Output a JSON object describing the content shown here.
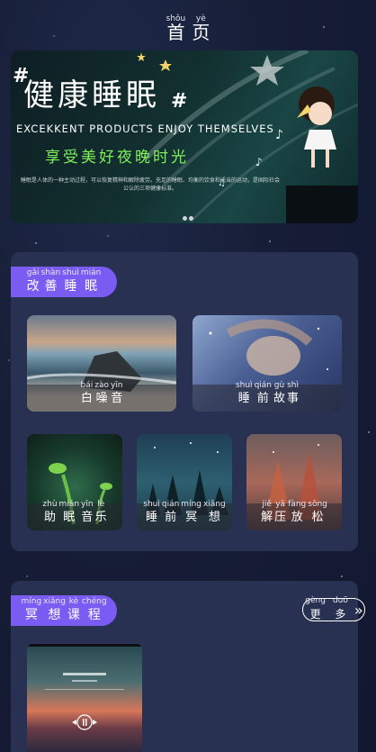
{
  "header": {
    "title": [
      {
        "py": "shǒu",
        "hz": "首"
      },
      {
        "py": "yè",
        "hz": "页"
      }
    ]
  },
  "banner": {
    "headline": "健康睡眠",
    "hash": "#",
    "subtitle_en": "EXCEKKENT PRODUCTS ENJOY THEMSELVES",
    "slogan_cn": "享受美好夜晚时光",
    "description": "睡眠是人体的一种主动过程，可以恢复精神和解除疲劳。充足的睡眠、均衡的饮食和适当的运动，是国际社会公认的三项健康标准。"
  },
  "improve_sleep": {
    "title": [
      {
        "py": "gǎi",
        "hz": "改"
      },
      {
        "py": "shàn",
        "hz": "善"
      },
      {
        "py": "shuì",
        "hz": "睡"
      },
      {
        "py": "mián",
        "hz": "眠"
      }
    ],
    "cards": [
      {
        "label": [
          {
            "py": "bái",
            "hz": "白"
          },
          {
            "py": "zào",
            "hz": "噪"
          },
          {
            "py": "yīn",
            "hz": "音"
          }
        ]
      },
      {
        "label": [
          {
            "py": "shuì",
            "hz": "睡"
          },
          {
            "py": "qián",
            "hz": "前"
          },
          {
            "py": "gù",
            "hz": "故"
          },
          {
            "py": "shì",
            "hz": "事"
          }
        ]
      },
      {
        "label": [
          {
            "py": "zhù",
            "hz": "助"
          },
          {
            "py": "mián",
            "hz": "眠"
          },
          {
            "py": "yīn",
            "hz": "音"
          },
          {
            "py": "lè",
            "hz": "乐"
          }
        ]
      },
      {
        "label": [
          {
            "py": "shuì",
            "hz": "睡"
          },
          {
            "py": "qián",
            "hz": "前"
          },
          {
            "py": "míng",
            "hz": "冥"
          },
          {
            "py": "xiǎng",
            "hz": "想"
          }
        ]
      },
      {
        "label": [
          {
            "py": "jiě",
            "hz": "解"
          },
          {
            "py": "yā",
            "hz": "压"
          },
          {
            "py": "fàng",
            "hz": "放"
          },
          {
            "py": "sōng",
            "hz": "松"
          }
        ]
      }
    ]
  },
  "meditation": {
    "title": [
      {
        "py": "míng",
        "hz": "冥"
      },
      {
        "py": "xiǎng",
        "hz": "想"
      },
      {
        "py": "kè",
        "hz": "课"
      },
      {
        "py": "chéng",
        "hz": "程"
      }
    ],
    "more": [
      {
        "py": "gèng",
        "hz": "更"
      },
      {
        "py": "duō",
        "hz": "多"
      }
    ],
    "more_icon": "»"
  },
  "colors": {
    "accent": "#7a5cf2",
    "panel": "#283152",
    "background": "#161d36",
    "slogan": "#7ef05a"
  }
}
